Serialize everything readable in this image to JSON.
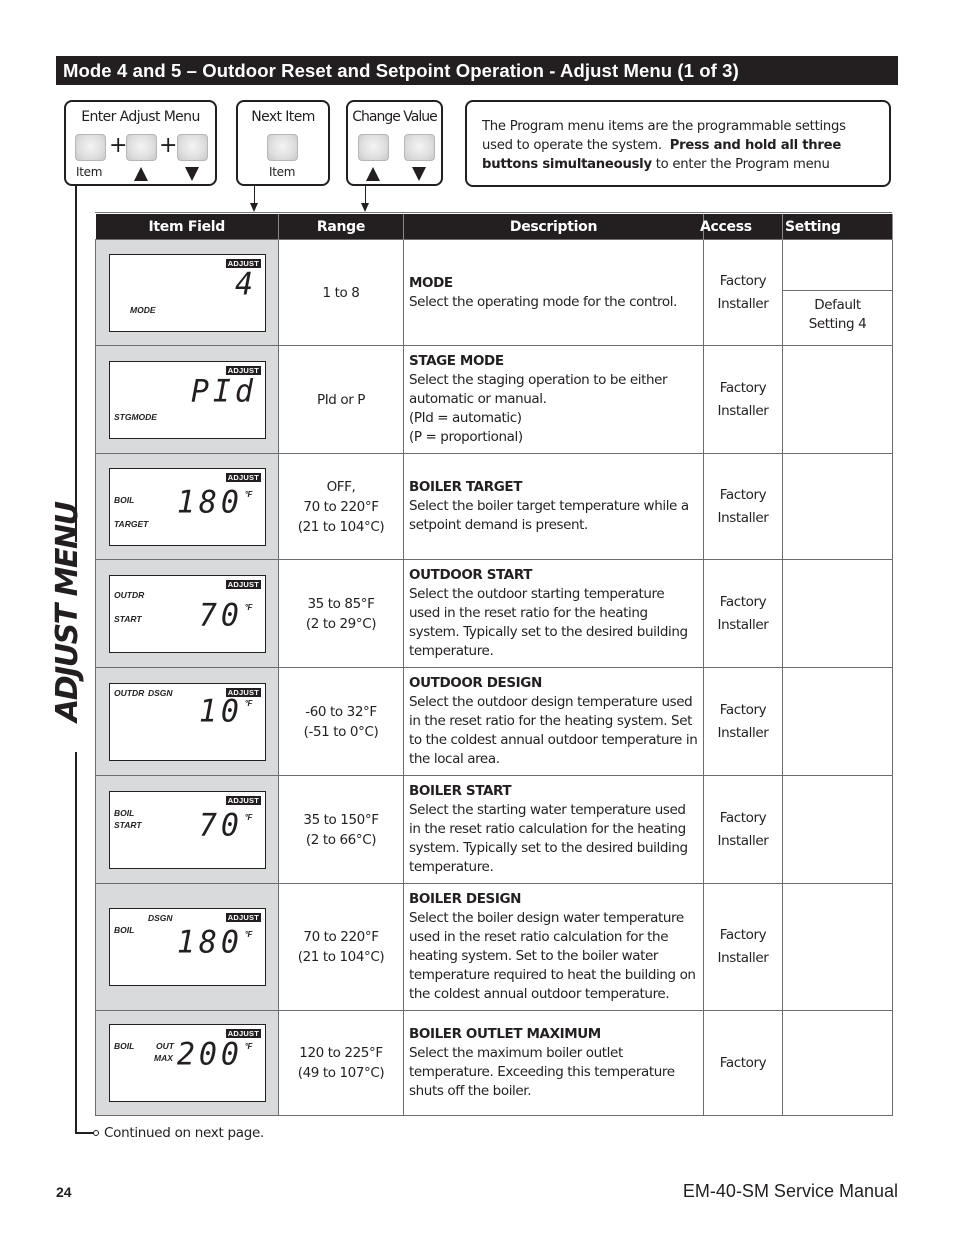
{
  "header": {
    "title": "Mode 4 and 5 – Outdoor Reset and Setpoint Operation - Adjust Menu (1 of 3)"
  },
  "controls": {
    "enter_adjust": {
      "title": "Enter Adjust Menu",
      "plus": "+",
      "item_label": "Item",
      "up_icon": "up-arrow-icon",
      "down_icon": "down-arrow-icon"
    },
    "next_item": {
      "title": "Next Item",
      "item_label": "Item"
    },
    "change_value": {
      "title": "Change Value",
      "up_icon": "up-arrow-icon",
      "down_icon": "down-arrow-icon"
    },
    "info": {
      "text_1": "The Program menu items are the programmable settings used to operate the system.",
      "text_bold": "Press and hold all three buttons simultaneously",
      "text_2": "to enter the Program menu"
    }
  },
  "side_label": "ADJUST MENU",
  "table": {
    "headers": [
      "Item Field",
      "Range",
      "Description",
      "Access",
      "Setting"
    ],
    "rows": [
      {
        "lcd": {
          "badge": "ADJUST",
          "digits": "4",
          "unit": "",
          "labels": [
            "MODE"
          ]
        },
        "range": [
          "1 to 8"
        ],
        "title": "MODE",
        "description": [
          "Select the operating mode for the control."
        ],
        "access": [
          "Factory",
          "Installer"
        ],
        "setting": "Default Setting 4"
      },
      {
        "lcd": {
          "badge": "ADJUST",
          "digits": "PId",
          "unit": "",
          "labels": [
            "STGMODE"
          ]
        },
        "range": [
          "PId or P"
        ],
        "title": "STAGE MODE",
        "description": [
          "Select the staging operation to be either automatic or manual.",
          "(PId = automatic)",
          "(P = proportional)"
        ],
        "access": [
          "Factory",
          "Installer"
        ],
        "setting": ""
      },
      {
        "lcd": {
          "badge": "ADJUST",
          "digits": "180",
          "unit": "°F",
          "labels": [
            "BOIL",
            "TARGET"
          ]
        },
        "range": [
          "OFF,",
          "70 to 220°F",
          "(21 to 104°C)"
        ],
        "title": "BOILER TARGET",
        "description": [
          "Select the boiler target temperature while a setpoint demand is present."
        ],
        "access": [
          "Factory",
          "Installer"
        ],
        "setting": ""
      },
      {
        "lcd": {
          "badge": "ADJUST",
          "digits": "70",
          "unit": "°F",
          "labels": [
            "OUTDR",
            "START"
          ]
        },
        "range": [
          "35 to 85°F",
          "(2 to 29°C)"
        ],
        "title": "OUTDOOR START",
        "description": [
          "Select the outdoor starting temperature used in the reset ratio for the heating system. Typically set to the desired building temperature."
        ],
        "access": [
          "Factory",
          "Installer"
        ],
        "setting": ""
      },
      {
        "lcd": {
          "badge": "ADJUST",
          "digits": "10",
          "unit": "°F",
          "labels": [
            "OUTDR",
            "DSGN"
          ]
        },
        "range": [
          "-60 to 32°F",
          "(-51 to 0°C)"
        ],
        "title": "OUTDOOR DESIGN",
        "description": [
          "Select the outdoor design temperature used in the reset ratio for the heating system. Set to the coldest annual outdoor temperature in the local area."
        ],
        "access": [
          "Factory",
          "Installer"
        ],
        "setting": ""
      },
      {
        "lcd": {
          "badge": "ADJUST",
          "digits": "70",
          "unit": "°F",
          "labels": [
            "BOIL",
            "START"
          ]
        },
        "range": [
          "35 to 150°F",
          "(2 to 66°C)"
        ],
        "title": "BOILER START",
        "description": [
          "Select the starting water temperature used in the reset ratio calculation for the heating system. Typically set to the desired building temperature."
        ],
        "access": [
          "Factory",
          "Installer"
        ],
        "setting": ""
      },
      {
        "lcd": {
          "badge": "ADJUST",
          "digits": "180",
          "unit": "°F",
          "labels": [
            "BOIL",
            "DSGN"
          ]
        },
        "range": [
          "70 to 220°F",
          "(21 to 104°C)"
        ],
        "title": "BOILER DESIGN",
        "description": [
          "Select the boiler design water temperature used in the reset ratio calculation for the heating system. Set to the boiler water temperature required to heat the building on the coldest annual outdoor temperature."
        ],
        "access": [
          "Factory",
          "Installer"
        ],
        "setting": ""
      },
      {
        "lcd": {
          "badge": "ADJUST",
          "digits": "200",
          "unit": "°F",
          "labels": [
            "BOIL",
            "OUT",
            "MAX"
          ]
        },
        "range": [
          "120 to 225°F",
          "(49 to 107°C)"
        ],
        "title": "BOILER OUTLET MAXIMUM",
        "description": [
          "Select the maximum boiler outlet temperature. Exceeding this temperature shuts off the boiler."
        ],
        "access": [
          "Factory"
        ],
        "setting": ""
      }
    ]
  },
  "footer": {
    "continued": "Continued on next page.",
    "page_number": "24",
    "manual_name": "EM-40-SM Service Manual"
  }
}
